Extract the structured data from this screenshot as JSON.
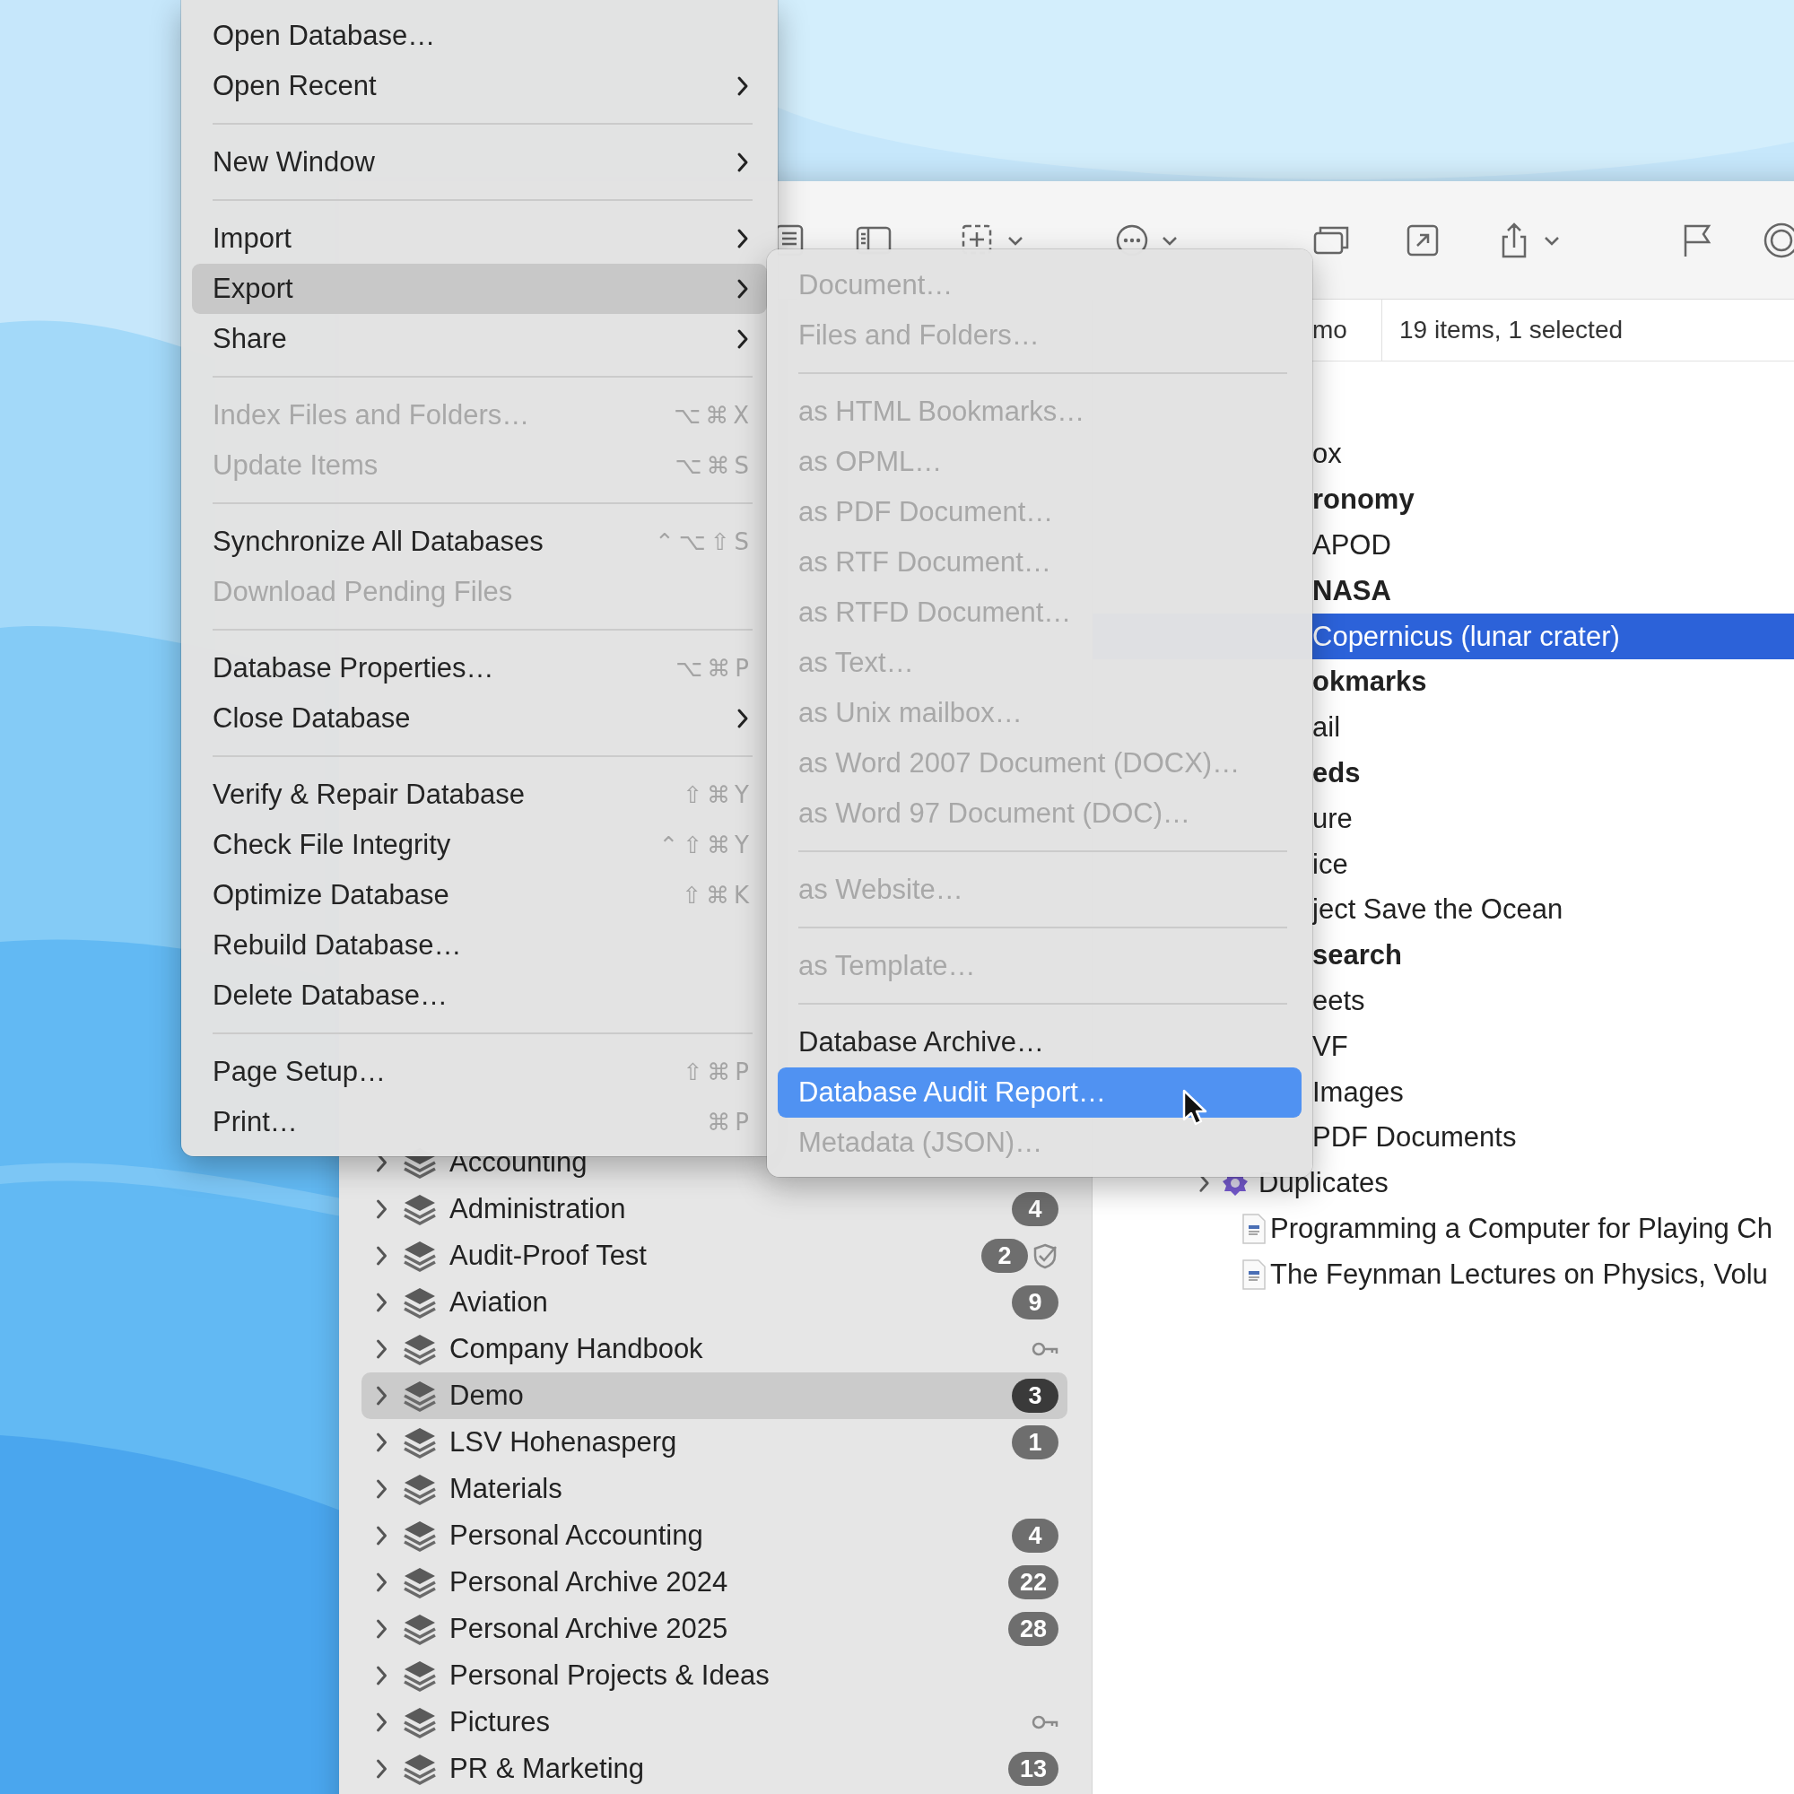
{
  "menu": {
    "items": [
      {
        "kind": "item",
        "label": "Open Database…",
        "has_submenu": false,
        "disabled": false,
        "selected": false
      },
      {
        "kind": "item",
        "label": "Open Recent",
        "has_submenu": true,
        "disabled": false,
        "selected": false
      },
      {
        "kind": "separator"
      },
      {
        "kind": "item",
        "label": "New Window",
        "has_submenu": true,
        "disabled": false,
        "selected": false
      },
      {
        "kind": "separator"
      },
      {
        "kind": "item",
        "label": "Import",
        "has_submenu": true,
        "disabled": false,
        "selected": false
      },
      {
        "kind": "item",
        "label": "Export",
        "has_submenu": true,
        "disabled": false,
        "selected": true
      },
      {
        "kind": "item",
        "label": "Share",
        "has_submenu": true,
        "disabled": false,
        "selected": false
      },
      {
        "kind": "separator"
      },
      {
        "kind": "item",
        "label": "Index Files and Folders…",
        "shortcut": "⌥⌘X",
        "has_submenu": false,
        "disabled": true,
        "selected": false
      },
      {
        "kind": "item",
        "label": "Update Items",
        "shortcut": "⌥⌘S",
        "has_submenu": false,
        "disabled": true,
        "selected": false
      },
      {
        "kind": "separator"
      },
      {
        "kind": "item",
        "label": "Synchronize All Databases",
        "shortcut": "⌃⌥⇧S",
        "has_submenu": false,
        "disabled": false,
        "selected": false
      },
      {
        "kind": "item",
        "label": "Download Pending Files",
        "has_submenu": false,
        "disabled": true,
        "selected": false
      },
      {
        "kind": "separator"
      },
      {
        "kind": "item",
        "label": "Database Properties…",
        "shortcut": "⌥⌘P",
        "has_submenu": false,
        "disabled": false,
        "selected": false
      },
      {
        "kind": "item",
        "label": "Close Database",
        "has_submenu": true,
        "disabled": false,
        "selected": false
      },
      {
        "kind": "separator"
      },
      {
        "kind": "item",
        "label": "Verify & Repair Database",
        "shortcut": "⇧⌘Y",
        "has_submenu": false,
        "disabled": false,
        "selected": false
      },
      {
        "kind": "item",
        "label": "Check File Integrity",
        "shortcut": "⌃⇧⌘Y",
        "has_submenu": false,
        "disabled": false,
        "selected": false
      },
      {
        "kind": "item",
        "label": "Optimize Database",
        "shortcut": "⇧⌘K",
        "has_submenu": false,
        "disabled": false,
        "selected": false
      },
      {
        "kind": "item",
        "label": "Rebuild Database…",
        "has_submenu": false,
        "disabled": false,
        "selected": false
      },
      {
        "kind": "item",
        "label": "Delete Database…",
        "has_submenu": false,
        "disabled": false,
        "selected": false
      },
      {
        "kind": "separator"
      },
      {
        "kind": "item",
        "label": "Page Setup…",
        "shortcut": "⇧⌘P",
        "has_submenu": false,
        "disabled": false,
        "selected": false
      },
      {
        "kind": "item",
        "label": "Print…",
        "shortcut": "⌘P",
        "has_submenu": false,
        "disabled": false,
        "selected": false
      }
    ]
  },
  "export_submenu": {
    "items": [
      {
        "kind": "item",
        "label": "Document…",
        "has_submenu": false,
        "disabled": true,
        "selected": false
      },
      {
        "kind": "item",
        "label": "Files and Folders…",
        "has_submenu": false,
        "disabled": true,
        "selected": false
      },
      {
        "kind": "separator"
      },
      {
        "kind": "item",
        "label": "as HTML Bookmarks…",
        "has_submenu": false,
        "disabled": true,
        "selected": false
      },
      {
        "kind": "item",
        "label": "as OPML…",
        "has_submenu": false,
        "disabled": true,
        "selected": false
      },
      {
        "kind": "item",
        "label": "as PDF Document…",
        "has_submenu": false,
        "disabled": true,
        "selected": false
      },
      {
        "kind": "item",
        "label": "as RTF Document…",
        "has_submenu": false,
        "disabled": true,
        "selected": false
      },
      {
        "kind": "item",
        "label": "as RTFD Document…",
        "has_submenu": false,
        "disabled": true,
        "selected": false
      },
      {
        "kind": "item",
        "label": "as Text…",
        "has_submenu": false,
        "disabled": true,
        "selected": false
      },
      {
        "kind": "item",
        "label": "as Unix mailbox…",
        "has_submenu": false,
        "disabled": true,
        "selected": false
      },
      {
        "kind": "item",
        "label": "as Word 2007 Document (DOCX)…",
        "has_submenu": false,
        "disabled": true,
        "selected": false
      },
      {
        "kind": "item",
        "label": "as Word 97 Document (DOC)…",
        "has_submenu": false,
        "disabled": true,
        "selected": false
      },
      {
        "kind": "separator"
      },
      {
        "kind": "item",
        "label": "as Website…",
        "has_submenu": false,
        "disabled": true,
        "selected": false
      },
      {
        "kind": "separator"
      },
      {
        "kind": "item",
        "label": "as Template…",
        "has_submenu": false,
        "disabled": true,
        "selected": false
      },
      {
        "kind": "separator"
      },
      {
        "kind": "item",
        "label": "Database Archive…",
        "has_submenu": false,
        "disabled": false,
        "selected": false
      },
      {
        "kind": "item",
        "label": "Database Audit Report…",
        "has_submenu": false,
        "disabled": false,
        "selected": true
      },
      {
        "kind": "item",
        "label": "Metadata (JSON)…",
        "has_submenu": false,
        "disabled": true,
        "selected": false
      }
    ]
  },
  "path_bar": {
    "location": "mo",
    "status": "19 items, 1 selected"
  },
  "sidebar": {
    "items": [
      {
        "kind": "plain",
        "label": "Accounting",
        "expanded": false,
        "selected": false
      },
      {
        "kind": "plain",
        "label": "Administration",
        "badge": "4",
        "expanded": false,
        "selected": false
      },
      {
        "kind": "verified",
        "label": "Audit-Proof Test",
        "badge": "2",
        "expanded": false,
        "selected": false
      },
      {
        "kind": "plain",
        "label": "Aviation",
        "badge": "9",
        "expanded": false,
        "selected": false
      },
      {
        "kind": "locked",
        "label": "Company Handbook",
        "expanded": false,
        "selected": false
      },
      {
        "kind": "plain",
        "label": "Demo",
        "badge": "3",
        "expanded": false,
        "selected": true
      },
      {
        "kind": "plain",
        "label": "LSV Hohenasperg",
        "badge": "1",
        "expanded": false,
        "selected": false
      },
      {
        "kind": "plain",
        "label": "Materials",
        "expanded": false,
        "selected": false
      },
      {
        "kind": "plain",
        "label": "Personal Accounting",
        "badge": "4",
        "expanded": false,
        "selected": false
      },
      {
        "kind": "plain",
        "label": "Personal Archive 2024",
        "badge": "22",
        "expanded": false,
        "selected": false
      },
      {
        "kind": "plain",
        "label": "Personal Archive 2025",
        "badge": "28",
        "expanded": false,
        "selected": false
      },
      {
        "kind": "plain",
        "label": "Personal Projects & Ideas",
        "expanded": false,
        "selected": false
      },
      {
        "kind": "locked",
        "label": "Pictures",
        "expanded": false,
        "selected": false
      },
      {
        "kind": "plain",
        "label": "PR & Marketing",
        "badge": "13",
        "expanded": false,
        "selected": false
      }
    ]
  },
  "documents": [
    {
      "kind": "item",
      "label": "ox",
      "selected": false
    },
    {
      "kind": "group",
      "label": "ronomy",
      "selected": false
    },
    {
      "kind": "item",
      "label": "APOD",
      "selected": false
    },
    {
      "kind": "group",
      "label": "NASA",
      "selected": false
    },
    {
      "kind": "item",
      "label": "Copernicus (lunar crater)",
      "selected": true
    },
    {
      "kind": "group",
      "label": "okmarks",
      "selected": false
    },
    {
      "kind": "item",
      "label": "ail",
      "selected": false
    },
    {
      "kind": "group",
      "label": "eds",
      "selected": false
    },
    {
      "kind": "item",
      "label": "ure",
      "selected": false
    },
    {
      "kind": "item",
      "label": "ice",
      "selected": false
    },
    {
      "kind": "item",
      "label": "ject Save the Ocean",
      "selected": false
    },
    {
      "kind": "group",
      "label": "search",
      "selected": false
    },
    {
      "kind": "item",
      "label": "eets",
      "selected": false
    },
    {
      "kind": "item",
      "label": "VF",
      "selected": false
    },
    {
      "kind": "item",
      "label": "Images",
      "selected": false
    },
    {
      "kind": "item",
      "label": "PDF Documents",
      "selected": false
    },
    {
      "kind": "smart-group",
      "label": "Duplicates",
      "selected": false
    },
    {
      "kind": "document",
      "label": "Programming a Computer for Playing Ch",
      "selected": false
    },
    {
      "kind": "document",
      "label": "The Feynman Lectures on Physics, Volu",
      "selected": false
    }
  ]
}
